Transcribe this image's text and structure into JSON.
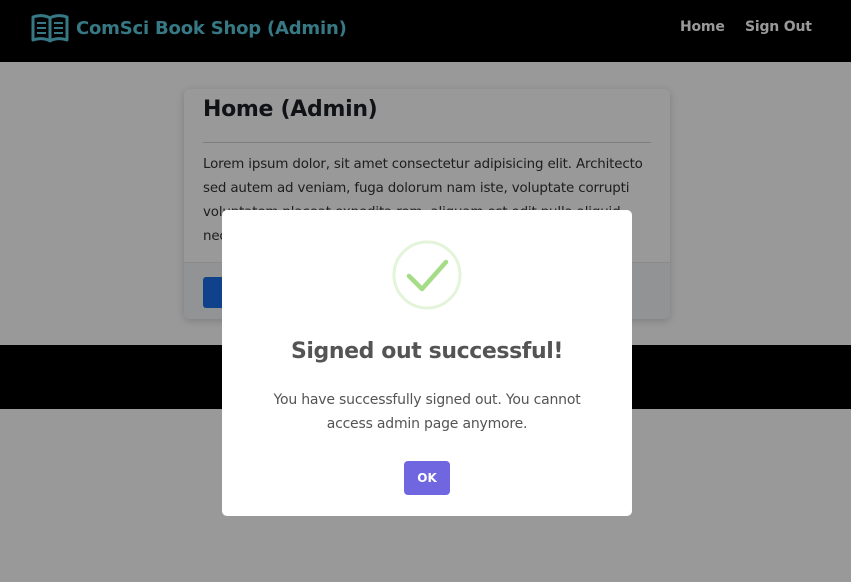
{
  "navbar": {
    "brand_icon": "open-book-icon",
    "brand_title": "ComSci Book Shop (Admin)",
    "links": [
      {
        "label": "Home"
      },
      {
        "label": "Sign Out"
      }
    ],
    "colors": {
      "background": "#000000",
      "brand": "#5bc8dc",
      "links": "#ffffff"
    }
  },
  "main": {
    "card": {
      "title": "Home (Admin)",
      "body": "Lorem ipsum dolor, sit amet consectetur adipisicing elit. Architecto sed autem ad veniam, fuga dolorum nam iste, voluptate corrupti voluptatem placeat expedita rem, aliquam est odit nulla aliquid nec",
      "button_color": "#1a6fe8"
    }
  },
  "modal": {
    "icon": "success-checkmark-icon",
    "title": "Signed out successful!",
    "message": "You have successfully signed out. You cannot access admin page anymore.",
    "confirm_label": "OK",
    "colors": {
      "icon": "#a5dc86",
      "confirm": "#7066e0",
      "text": "#545454"
    }
  }
}
